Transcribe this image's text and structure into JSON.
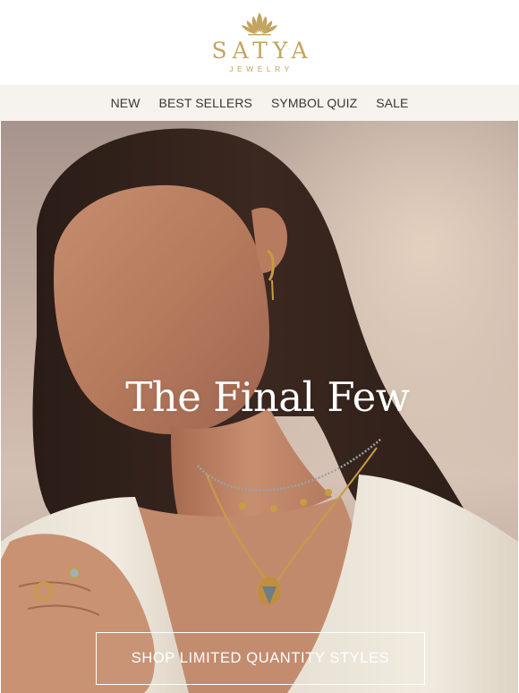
{
  "brand": {
    "name": "SATYA",
    "subtitle": "JEWELRY",
    "color": "#c3a35e",
    "logo_icon": "lotus-icon"
  },
  "nav": {
    "background": "#f6f2ee",
    "items": [
      {
        "label": "NEW"
      },
      {
        "label": "BEST SELLERS"
      },
      {
        "label": "SYMBOL QUIZ"
      },
      {
        "label": "SALE"
      }
    ]
  },
  "hero": {
    "headline": "The Final Few",
    "cta_label": "SHOP LIMITED QUANTITY STYLES",
    "image": "woman-wearing-gold-jewelry-photo"
  }
}
